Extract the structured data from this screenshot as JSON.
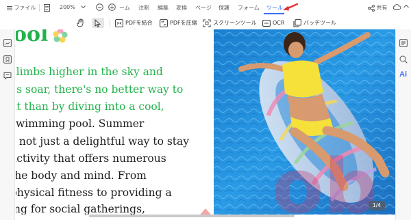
{
  "menubar": {
    "file_label": "ファイル",
    "zoom_value": "200%",
    "home_label": "ーム",
    "annotate_label": "注釈",
    "edit_label": "編集",
    "convert_label": "変換",
    "page_label": "ページ",
    "protect_label": "保護",
    "form_label": "フォーム",
    "tool_label": "ツール",
    "share_label": "共有"
  },
  "toolbar": {
    "merge_pdf": "PDFを結合",
    "compress_pdf": "PDFを圧縮",
    "screen_tool": "スクリーンツール",
    "ocr": "OCR",
    "batch_tool": "バッチツール"
  },
  "document": {
    "title_fragment": "ool",
    "lines": [
      "climbs higher in the sky and",
      "es soar, there's no better way to",
      "at than by diving into a cool,",
      "swimming pool. Summer",
      "s not just a delightful way to stay",
      "activity that offers numerous",
      " the body and mind. From",
      "physical fitness to providing a",
      "ing for social gatherings,"
    ],
    "page_counter": "1/4"
  },
  "rightbar": {
    "ai_label": "Ai"
  },
  "colors": {
    "accent": "#3d6ef5",
    "doc_green": "#22b24c",
    "annotation_red": "#e03131",
    "pool_blue": "#1e8fd8"
  }
}
